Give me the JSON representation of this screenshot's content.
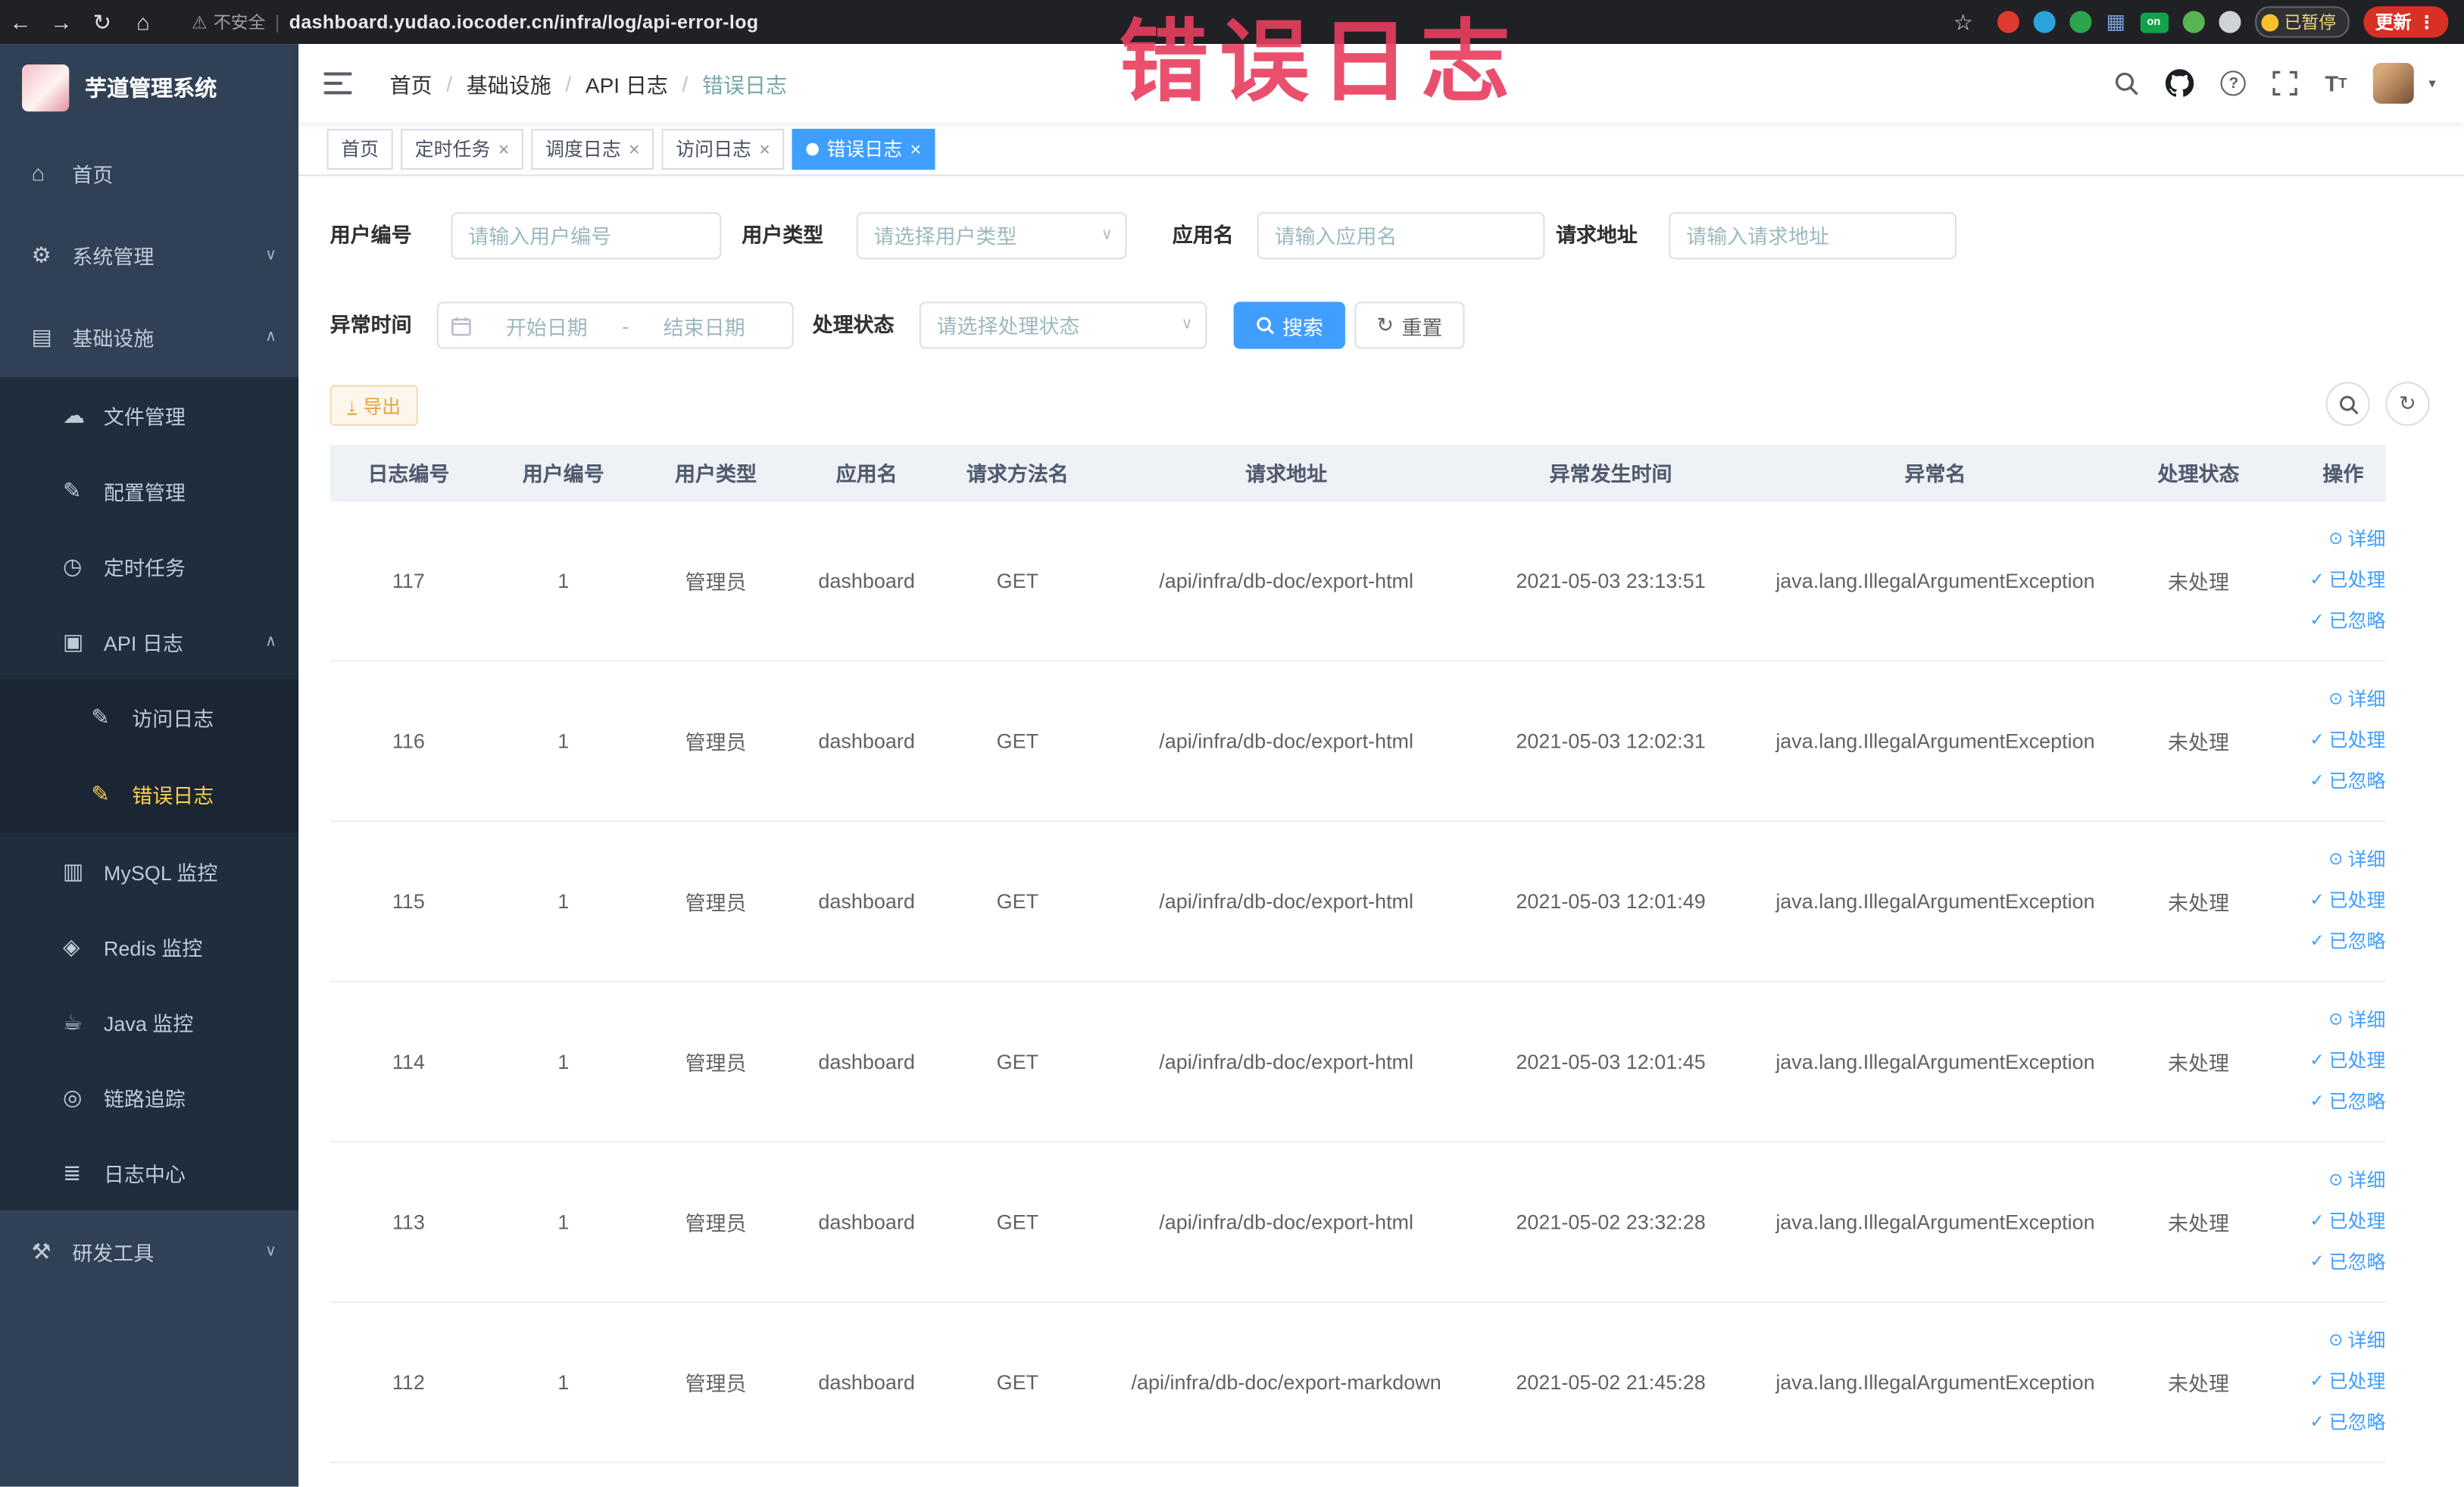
{
  "colors": {
    "primary": "#409eff",
    "sidebar_bg": "#304156",
    "submenu_bg": "#1f2d3d",
    "menu_active": "#ffd04b",
    "warning": "#e6a23c",
    "annotation": "#e83e5e"
  },
  "browser": {
    "security_label": "不安全",
    "url": "dashboard.yudao.iocoder.cn/infra/log/api-error-log",
    "on_badge": "on",
    "paused_label": "已暂停",
    "update_label": "更新"
  },
  "annotation": {
    "text": "错误日志"
  },
  "icons": {
    "back": "←",
    "forward": "→",
    "reload": "↻",
    "home": "⌂",
    "warning": "⚠",
    "star": "☆",
    "more": "⋮",
    "check": "✓",
    "eye": "⊙",
    "refresh": "↻",
    "chevron_down": "∨",
    "chevron_up": "∧",
    "caret_down": "▾",
    "close": "×",
    "grid": "▦",
    "separator": "|",
    "help": "?",
    "range_separator": "-",
    "download": "↓"
  },
  "sidebar": {
    "logo_title": "芋道管理系统",
    "items": [
      {
        "label": "首页",
        "icon_glyph": "⌂"
      },
      {
        "label": "系统管理",
        "icon_glyph": "⚙"
      },
      {
        "label": "基础设施",
        "icon_glyph": "▤"
      },
      {
        "label": "文件管理",
        "icon_glyph": "☁"
      },
      {
        "label": "配置管理",
        "icon_glyph": "✎"
      },
      {
        "label": "定时任务",
        "icon_glyph": "◷"
      },
      {
        "label": "API 日志",
        "icon_glyph": "▣"
      },
      {
        "label": "访问日志",
        "icon_glyph": "✎"
      },
      {
        "label": "错误日志",
        "icon_glyph": "✎"
      },
      {
        "label": "MySQL 监控",
        "icon_glyph": "▥"
      },
      {
        "label": "Redis 监控",
        "icon_glyph": "◈"
      },
      {
        "label": "Java 监控",
        "icon_glyph": "☕"
      },
      {
        "label": "链路追踪",
        "icon_glyph": "◎"
      },
      {
        "label": "日志中心",
        "icon_glyph": "≣"
      },
      {
        "label": "研发工具",
        "icon_glyph": "⚒"
      }
    ]
  },
  "header": {
    "breadcrumb": {
      "items": [
        "首页",
        "基础设施",
        "API 日志",
        "错误日志"
      ],
      "separator": "/"
    }
  },
  "tabs": {
    "items": [
      "首页",
      "定时任务",
      "调度日志",
      "访问日志",
      "错误日志"
    ]
  },
  "filters": {
    "user_id_label": "用户编号",
    "user_id_placeholder": "请输入用户编号",
    "user_type_label": "用户类型",
    "user_type_placeholder": "请选择用户类型",
    "app_name_label": "应用名",
    "app_name_placeholder": "请输入应用名",
    "request_url_label": "请求地址",
    "request_url_placeholder": "请输入请求地址",
    "time_label": "异常时间",
    "time_start_placeholder": "开始日期",
    "time_end_placeholder": "结束日期",
    "status_label": "处理状态",
    "status_placeholder": "请选择处理状态",
    "search_label": "搜索",
    "reset_label": "重置"
  },
  "toolbar": {
    "export_label": "导出"
  },
  "table": {
    "columns": [
      "日志编号",
      "用户编号",
      "用户类型",
      "应用名",
      "请求方法名",
      "请求地址",
      "异常发生时间",
      "异常名",
      "处理状态",
      "操作"
    ],
    "actions": [
      "详细",
      "已处理",
      "已忽略"
    ],
    "rows": [
      {
        "id": "117",
        "user_id": "1",
        "user_type": "管理员",
        "app": "dashboard",
        "method": "GET",
        "url": "/api/infra/db-doc/export-html",
        "time": "2021-05-03 23:13:51",
        "exception": "java.lang.IllegalArgumentException",
        "status": "未处理"
      },
      {
        "id": "116",
        "user_id": "1",
        "user_type": "管理员",
        "app": "dashboard",
        "method": "GET",
        "url": "/api/infra/db-doc/export-html",
        "time": "2021-05-03 12:02:31",
        "exception": "java.lang.IllegalArgumentException",
        "status": "未处理"
      },
      {
        "id": "115",
        "user_id": "1",
        "user_type": "管理员",
        "app": "dashboard",
        "method": "GET",
        "url": "/api/infra/db-doc/export-html",
        "time": "2021-05-03 12:01:49",
        "exception": "java.lang.IllegalArgumentException",
        "status": "未处理"
      },
      {
        "id": "114",
        "user_id": "1",
        "user_type": "管理员",
        "app": "dashboard",
        "method": "GET",
        "url": "/api/infra/db-doc/export-html",
        "time": "2021-05-03 12:01:45",
        "exception": "java.lang.IllegalArgumentException",
        "status": "未处理"
      },
      {
        "id": "113",
        "user_id": "1",
        "user_type": "管理员",
        "app": "dashboard",
        "method": "GET",
        "url": "/api/infra/db-doc/export-html",
        "time": "2021-05-02 23:32:28",
        "exception": "java.lang.IllegalArgumentException",
        "status": "未处理"
      },
      {
        "id": "112",
        "user_id": "1",
        "user_type": "管理员",
        "app": "dashboard",
        "method": "GET",
        "url": "/api/infra/db-doc/export-markdown",
        "time": "2021-05-02 21:45:28",
        "exception": "java.lang.IllegalArgumentException",
        "status": "未处理"
      }
    ]
  }
}
